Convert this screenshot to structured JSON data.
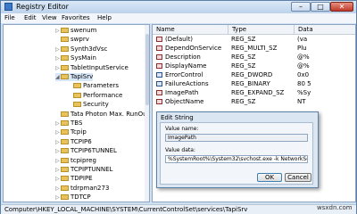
{
  "window": {
    "title": "Registry Editor",
    "min": "–",
    "max": "□",
    "close": "✕"
  },
  "menu": [
    "File",
    "Edit",
    "View",
    "Favorites",
    "Help"
  ],
  "tree": [
    {
      "label": "swenum",
      "indent": 0,
      "arrow": "▷"
    },
    {
      "label": "swprv",
      "indent": 0,
      "arrow": ""
    },
    {
      "label": "Synth3dVsc",
      "indent": 0,
      "arrow": "▷"
    },
    {
      "label": "SysMain",
      "indent": 0,
      "arrow": "▷"
    },
    {
      "label": "TabletInputService",
      "indent": 0,
      "arrow": "▷"
    },
    {
      "label": "TapiSrv",
      "indent": 0,
      "arrow": "◢",
      "selected": true
    },
    {
      "label": "Parameters",
      "indent": 1,
      "arrow": ""
    },
    {
      "label": "Performance",
      "indent": 1,
      "arrow": ""
    },
    {
      "label": "Security",
      "indent": 1,
      "arrow": ""
    },
    {
      "label": "Tata Photon Max. RunOuc",
      "indent": 0,
      "arrow": ""
    },
    {
      "label": "TBS",
      "indent": 0,
      "arrow": "▷"
    },
    {
      "label": "Tcpip",
      "indent": 0,
      "arrow": "▷"
    },
    {
      "label": "TCPIP6",
      "indent": 0,
      "arrow": "▷"
    },
    {
      "label": "TCPIP6TUNNEL",
      "indent": 0,
      "arrow": "▷"
    },
    {
      "label": "tcpipreg",
      "indent": 0,
      "arrow": "▷"
    },
    {
      "label": "TCPIPTUNNEL",
      "indent": 0,
      "arrow": "▷"
    },
    {
      "label": "TDPIPE",
      "indent": 0,
      "arrow": "▷"
    },
    {
      "label": "tdrpman273",
      "indent": 0,
      "arrow": "▷"
    },
    {
      "label": "TDTCP",
      "indent": 0,
      "arrow": "▷"
    }
  ],
  "columns": {
    "name": "Name",
    "type": "Type",
    "data": "Data"
  },
  "values": [
    {
      "name": "(Default)",
      "type": "REG_SZ",
      "data": "(va",
      "icon": "ab"
    },
    {
      "name": "DependOnService",
      "type": "REG_MULTI_SZ",
      "data": "Plu",
      "icon": "ab"
    },
    {
      "name": "Description",
      "type": "REG_SZ",
      "data": "@%",
      "icon": "ab"
    },
    {
      "name": "DisplayName",
      "type": "REG_SZ",
      "data": "@%",
      "icon": "ab"
    },
    {
      "name": "ErrorControl",
      "type": "REG_DWORD",
      "data": "0x0",
      "icon": "bin"
    },
    {
      "name": "FailureActions",
      "type": "REG_BINARY",
      "data": "80 5",
      "icon": "bin"
    },
    {
      "name": "ImagePath",
      "type": "REG_EXPAND_SZ",
      "data": "%Sy",
      "icon": "ab"
    },
    {
      "name": "ObjectName",
      "type": "REG_SZ",
      "data": "NT",
      "icon": "ab"
    }
  ],
  "status": "Computer\\HKEY_LOCAL_MACHINE\\SYSTEM\\CurrentControlSet\\services\\TapiSrv",
  "dialog": {
    "title": "Edit String",
    "value_name_label": "Value name:",
    "value_name": "ImagePath",
    "value_data_label": "Value data:",
    "value_data": "%SystemRoot%\\System32\\svchost.exe -k NetworkService",
    "ok": "OK",
    "cancel": "Cancel"
  },
  "watermark": "wsxdn.com"
}
